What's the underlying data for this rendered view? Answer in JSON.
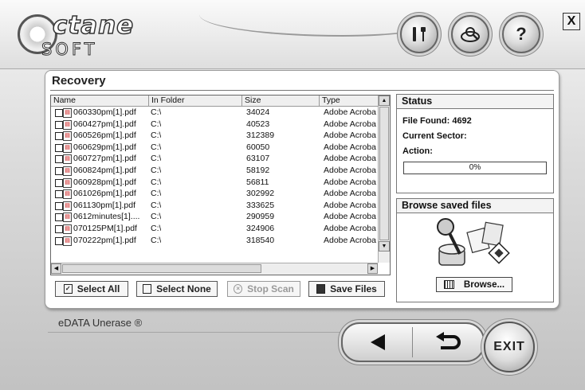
{
  "app": {
    "brand_name": "ctane",
    "brand_sub": "SOFT",
    "product": "eDATA Unerase ®"
  },
  "toolbar": {
    "tools_icon": "tools-icon",
    "scan_icon": "scan-icon",
    "help_label": "?",
    "close_label": "X"
  },
  "panel": {
    "title": "Recovery"
  },
  "list": {
    "columns": [
      "Name",
      "In Folder",
      "Size",
      "Type"
    ],
    "rows": [
      {
        "name": "060330pm[1].pdf",
        "folder": "C:\\",
        "size": "34024",
        "type": "Adobe Acroba"
      },
      {
        "name": "060427pm[1].pdf",
        "folder": "C:\\",
        "size": "40523",
        "type": "Adobe Acroba"
      },
      {
        "name": "060526pm[1].pdf",
        "folder": "C:\\",
        "size": "312389",
        "type": "Adobe Acroba"
      },
      {
        "name": "060629pm[1].pdf",
        "folder": "C:\\",
        "size": "60050",
        "type": "Adobe Acroba"
      },
      {
        "name": "060727pm[1].pdf",
        "folder": "C:\\",
        "size": "63107",
        "type": "Adobe Acroba"
      },
      {
        "name": "060824pm[1].pdf",
        "folder": "C:\\",
        "size": "58192",
        "type": "Adobe Acroba"
      },
      {
        "name": "060928pm[1].pdf",
        "folder": "C:\\",
        "size": "56811",
        "type": "Adobe Acroba"
      },
      {
        "name": "061026pm[1].pdf",
        "folder": "C:\\",
        "size": "302992",
        "type": "Adobe Acroba"
      },
      {
        "name": "061130pm[1].pdf",
        "folder": "C:\\",
        "size": "333625",
        "type": "Adobe Acroba"
      },
      {
        "name": "0612minutes[1]....",
        "folder": "C:\\",
        "size": "290959",
        "type": "Adobe Acroba"
      },
      {
        "name": "070125PM[1].pdf",
        "folder": "C:\\",
        "size": "324906",
        "type": "Adobe Acroba"
      },
      {
        "name": "070222pm[1].pdf",
        "folder": "C:\\",
        "size": "318540",
        "type": "Adobe Acroba"
      }
    ]
  },
  "buttons": {
    "select_all": "Select All",
    "select_none": "Select None",
    "stop_scan": "Stop Scan",
    "save_files": "Save Files"
  },
  "status": {
    "title": "Status",
    "file_found": "File Found: 4692",
    "current_sector": "Current Sector:",
    "action": "Action:",
    "progress_text": "0%",
    "progress_value": 0
  },
  "browse": {
    "title": "Browse saved files",
    "button": "Browse..."
  },
  "nav": {
    "back_icon": "back-arrow-icon",
    "undo_icon": "return-arrow-icon",
    "exit_label": "EXIT"
  }
}
